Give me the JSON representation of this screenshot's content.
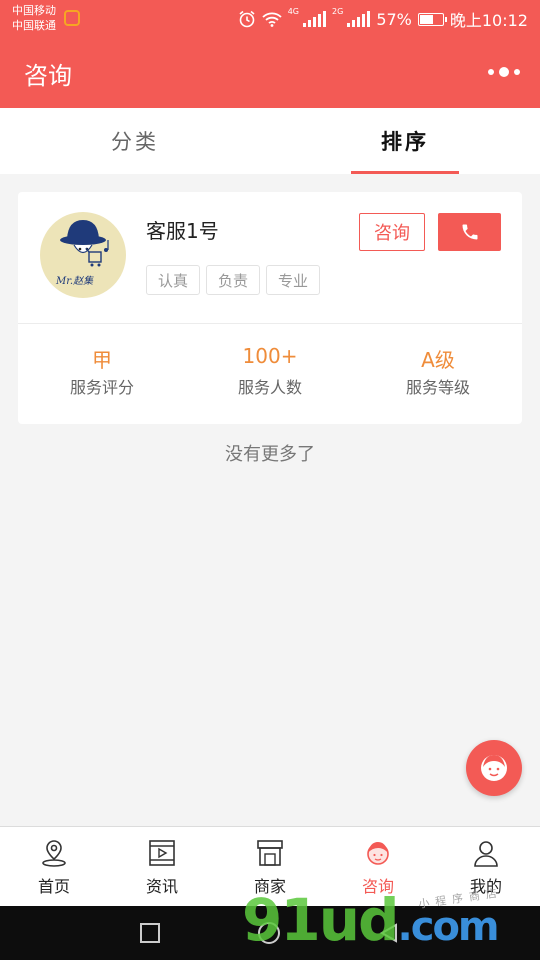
{
  "status_bar": {
    "carrier_1": "中国移动",
    "carrier_2": "中国联通",
    "net_4g": "4G",
    "net_2g": "2G",
    "battery": "57%",
    "time": "晚上10:12"
  },
  "nav": {
    "title": "咨询"
  },
  "tabs": [
    {
      "label": "分类",
      "active": false
    },
    {
      "label": "排序",
      "active": true
    }
  ],
  "card": {
    "name": "客服1号",
    "avatar_text": "Mr.赵集",
    "consult_label": "咨询",
    "tags": [
      "认真",
      "负责",
      "专业"
    ],
    "stats": [
      {
        "value": "甲",
        "label": "服务评分"
      },
      {
        "value": "100+",
        "label": "服务人数"
      },
      {
        "value": "A级",
        "label": "服务等级"
      }
    ]
  },
  "no_more": "没有更多了",
  "tabbar": [
    {
      "label": "首页",
      "icon": "location-pin-icon",
      "active": false
    },
    {
      "label": "资讯",
      "icon": "video-play-icon",
      "active": false
    },
    {
      "label": "商家",
      "icon": "shop-icon",
      "active": false
    },
    {
      "label": "咨询",
      "icon": "customer-service-icon",
      "active": true
    },
    {
      "label": "我的",
      "icon": "user-icon",
      "active": false
    }
  ],
  "watermark": {
    "main": "91ud",
    "domain": ".com",
    "small": "小程序商店"
  },
  "colors": {
    "primary": "#f35a55",
    "stat_value": "#ef8c3a",
    "avatar_bg": "#ede4b8"
  }
}
